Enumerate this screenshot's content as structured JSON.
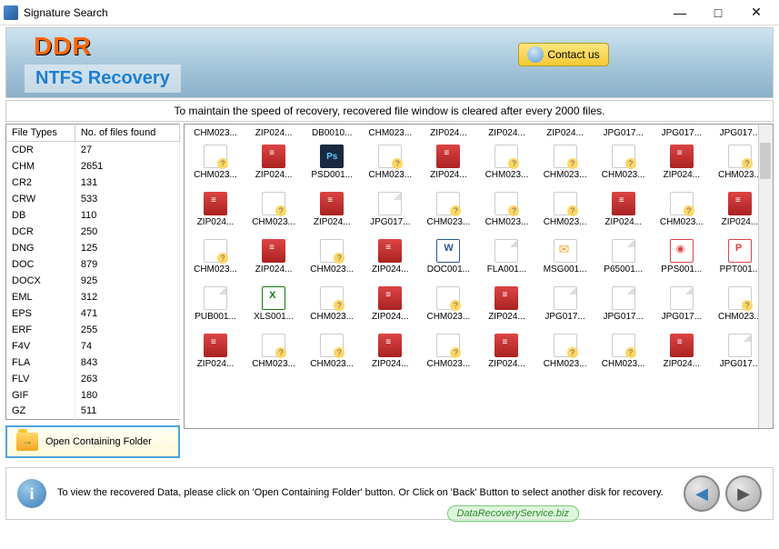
{
  "window": {
    "title": "Signature Search"
  },
  "header": {
    "logo": "DDR",
    "subtitle": "NTFS Recovery",
    "contact_label": "Contact us"
  },
  "info_strip": "To maintain the speed of recovery, recovered file window is cleared after every 2000 files.",
  "file_types_table": {
    "col1": "File Types",
    "col2": "No. of files found",
    "rows": [
      {
        "type": "CDR",
        "count": 27
      },
      {
        "type": "CHM",
        "count": 2651
      },
      {
        "type": "CR2",
        "count": 131
      },
      {
        "type": "CRW",
        "count": 533
      },
      {
        "type": "DB",
        "count": 110
      },
      {
        "type": "DCR",
        "count": 250
      },
      {
        "type": "DNG",
        "count": 125
      },
      {
        "type": "DOC",
        "count": 879
      },
      {
        "type": "DOCX",
        "count": 925
      },
      {
        "type": "EML",
        "count": 312
      },
      {
        "type": "EPS",
        "count": 471
      },
      {
        "type": "ERF",
        "count": 255
      },
      {
        "type": "F4V",
        "count": 74
      },
      {
        "type": "FLA",
        "count": 843
      },
      {
        "type": "FLV",
        "count": 263
      },
      {
        "type": "GIF",
        "count": 180
      },
      {
        "type": "GZ",
        "count": 511
      }
    ]
  },
  "open_folder_label": "Open Containing Folder",
  "file_grid": {
    "row0": [
      {
        "label": "CHM023...",
        "icon": ""
      },
      {
        "label": "ZIP024...",
        "icon": ""
      },
      {
        "label": "DB0010...",
        "icon": ""
      },
      {
        "label": "CHM023...",
        "icon": ""
      },
      {
        "label": "ZIP024...",
        "icon": ""
      },
      {
        "label": "ZIP024...",
        "icon": ""
      },
      {
        "label": "ZIP024...",
        "icon": ""
      },
      {
        "label": "JPG017...",
        "icon": ""
      },
      {
        "label": "JPG017...",
        "icon": ""
      },
      {
        "label": "JPG017...",
        "icon": ""
      }
    ],
    "rows": [
      [
        {
          "label": "CHM023...",
          "icon": "chm"
        },
        {
          "label": "ZIP024...",
          "icon": "zip"
        },
        {
          "label": "PSD001...",
          "icon": "psd"
        },
        {
          "label": "CHM023...",
          "icon": "chm"
        },
        {
          "label": "ZIP024...",
          "icon": "zip"
        },
        {
          "label": "CHM023...",
          "icon": "chm"
        },
        {
          "label": "CHM023...",
          "icon": "chm"
        },
        {
          "label": "CHM023...",
          "icon": "chm"
        },
        {
          "label": "ZIP024...",
          "icon": "zip"
        },
        {
          "label": "CHM023...",
          "icon": "chm"
        }
      ],
      [
        {
          "label": "ZIP024...",
          "icon": "zip"
        },
        {
          "label": "CHM023...",
          "icon": "chm"
        },
        {
          "label": "ZIP024...",
          "icon": "zip"
        },
        {
          "label": "JPG017...",
          "icon": "blank"
        },
        {
          "label": "CHM023...",
          "icon": "chm"
        },
        {
          "label": "CHM023...",
          "icon": "chm"
        },
        {
          "label": "CHM023...",
          "icon": "chm"
        },
        {
          "label": "ZIP024...",
          "icon": "zip"
        },
        {
          "label": "CHM023...",
          "icon": "chm"
        },
        {
          "label": "ZIP024...",
          "icon": "zip"
        }
      ],
      [
        {
          "label": "CHM023...",
          "icon": "chm"
        },
        {
          "label": "ZIP024...",
          "icon": "zip"
        },
        {
          "label": "CHM023...",
          "icon": "chm"
        },
        {
          "label": "ZIP024...",
          "icon": "zip"
        },
        {
          "label": "DOC001...",
          "icon": "doc"
        },
        {
          "label": "FLA001...",
          "icon": "blank"
        },
        {
          "label": "MSG001...",
          "icon": "msg"
        },
        {
          "label": "P65001...",
          "icon": "blank"
        },
        {
          "label": "PPS001...",
          "icon": "pps"
        },
        {
          "label": "PPT001...",
          "icon": "ppt"
        }
      ],
      [
        {
          "label": "PUB001...",
          "icon": "blank"
        },
        {
          "label": "XLS001...",
          "icon": "xls"
        },
        {
          "label": "CHM023...",
          "icon": "chm"
        },
        {
          "label": "ZIP024...",
          "icon": "zip"
        },
        {
          "label": "CHM023...",
          "icon": "chm"
        },
        {
          "label": "ZIP024...",
          "icon": "zip"
        },
        {
          "label": "JPG017...",
          "icon": "blank"
        },
        {
          "label": "JPG017...",
          "icon": "blank"
        },
        {
          "label": "JPG017...",
          "icon": "blank"
        },
        {
          "label": "CHM023...",
          "icon": "chm"
        }
      ],
      [
        {
          "label": "ZIP024...",
          "icon": "zip"
        },
        {
          "label": "CHM023...",
          "icon": "chm"
        },
        {
          "label": "CHM023...",
          "icon": "chm"
        },
        {
          "label": "ZIP024...",
          "icon": "zip"
        },
        {
          "label": "CHM023...",
          "icon": "chm"
        },
        {
          "label": "ZIP024...",
          "icon": "zip"
        },
        {
          "label": "CHM023...",
          "icon": "chm"
        },
        {
          "label": "CHM023...",
          "icon": "chm"
        },
        {
          "label": "ZIP024...",
          "icon": "zip"
        },
        {
          "label": "JPG017...",
          "icon": "blank"
        }
      ]
    ]
  },
  "footer": {
    "text": "To view the recovered Data, please click on 'Open Containing Folder' button. Or Click on 'Back' Button to select another disk for recovery."
  },
  "watermark": "DataRecoveryService.biz"
}
